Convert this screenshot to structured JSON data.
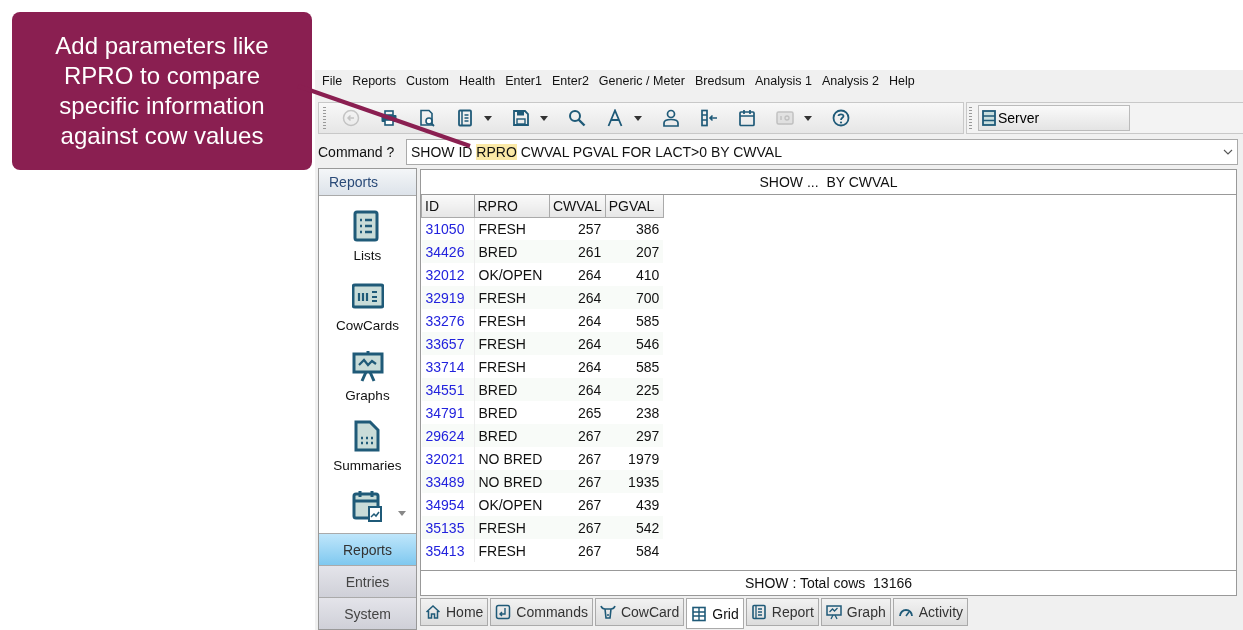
{
  "callout": {
    "text": "Add parameters like RPRO to compare specific information against cow values"
  },
  "menu": [
    "File",
    "Reports",
    "Custom",
    "Health",
    "Enter1",
    "Enter2",
    "Generic / Meter",
    "Bredsum",
    "Analysis 1",
    "Analysis 2",
    "Help"
  ],
  "toolbar": {
    "buttons": [
      {
        "kind": "back",
        "disabled": true,
        "dropdown": false
      },
      {
        "kind": "print",
        "disabled": false,
        "dropdown": false
      },
      {
        "kind": "preview",
        "disabled": false,
        "dropdown": false
      },
      {
        "kind": "book",
        "disabled": false,
        "dropdown": true
      },
      {
        "kind": "save",
        "disabled": false,
        "dropdown": true
      },
      {
        "kind": "search",
        "disabled": false,
        "dropdown": false
      },
      {
        "kind": "font",
        "disabled": false,
        "dropdown": true
      },
      {
        "kind": "person",
        "disabled": false,
        "dropdown": false
      },
      {
        "kind": "columns",
        "disabled": false,
        "dropdown": false
      },
      {
        "kind": "calendar",
        "disabled": false,
        "dropdown": false
      },
      {
        "kind": "card",
        "disabled": true,
        "dropdown": true
      },
      {
        "kind": "help",
        "disabled": false,
        "dropdown": false
      }
    ],
    "server": "Server"
  },
  "command": {
    "label": "Command ?",
    "segments": [
      {
        "text": "SHOW ID ",
        "highlighted": false
      },
      {
        "text": "RPRO",
        "highlighted": true
      },
      {
        "text": " CWVAL PGVAL FOR LACT>0 BY CWVAL",
        "highlighted": false
      }
    ]
  },
  "sidebar": {
    "header": "Reports",
    "items": [
      {
        "kind": "list",
        "label": "Lists"
      },
      {
        "kind": "card",
        "label": "CowCards"
      },
      {
        "kind": "graph",
        "label": "Graphs"
      },
      {
        "kind": "summary",
        "label": "Summaries"
      }
    ],
    "nav": [
      {
        "label": "Reports",
        "selected": true
      },
      {
        "label": "Entries",
        "selected": false
      },
      {
        "label": "System",
        "selected": false
      }
    ]
  },
  "grid": {
    "title": "SHOW ...  BY CWVAL",
    "columns": [
      "ID",
      "RPRO",
      "CWVAL",
      "PGVAL"
    ],
    "rows": [
      [
        "31050",
        "FRESH",
        "257",
        "386"
      ],
      [
        "34426",
        "BRED",
        "261",
        "207"
      ],
      [
        "32012",
        "OK/OPEN",
        "264",
        "410"
      ],
      [
        "32919",
        "FRESH",
        "264",
        "700"
      ],
      [
        "33276",
        "FRESH",
        "264",
        "585"
      ],
      [
        "33657",
        "FRESH",
        "264",
        "546"
      ],
      [
        "33714",
        "FRESH",
        "264",
        "585"
      ],
      [
        "34551",
        "BRED",
        "264",
        "225"
      ],
      [
        "34791",
        "BRED",
        "265",
        "238"
      ],
      [
        "29624",
        "BRED",
        "267",
        "297"
      ],
      [
        "32021",
        "NO BRED",
        "267",
        "1979"
      ],
      [
        "33489",
        "NO BRED",
        "267",
        "1935"
      ],
      [
        "34954",
        "OK/OPEN",
        "267",
        "439"
      ],
      [
        "35135",
        "FRESH",
        "267",
        "542"
      ],
      [
        "35413",
        "FRESH",
        "267",
        "584"
      ]
    ],
    "status": "SHOW : Total cows  13166"
  },
  "tabs": [
    {
      "kind": "home",
      "label": "Home",
      "selected": false
    },
    {
      "kind": "commands",
      "label": "Commands",
      "selected": false
    },
    {
      "kind": "cow",
      "label": "CowCard",
      "selected": false
    },
    {
      "kind": "grid",
      "label": "Grid",
      "selected": true
    },
    {
      "kind": "report",
      "label": "Report",
      "selected": false
    },
    {
      "kind": "graph",
      "label": "Graph",
      "selected": false
    },
    {
      "kind": "activity",
      "label": "Activity",
      "selected": false
    }
  ]
}
